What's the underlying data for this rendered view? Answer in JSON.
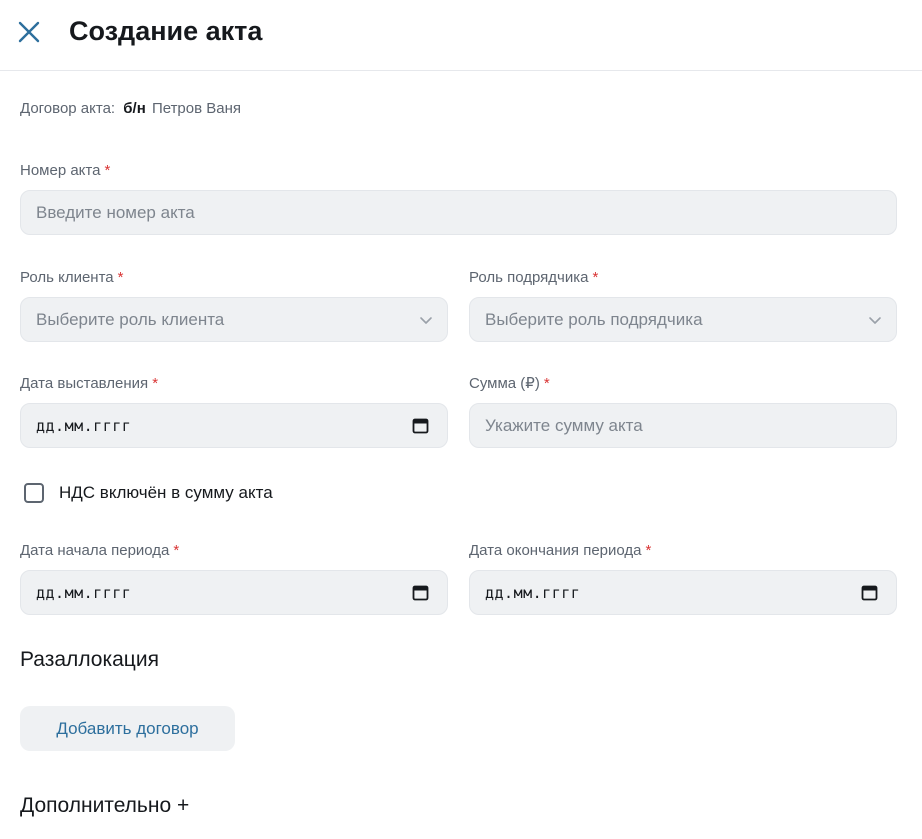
{
  "header": {
    "title": "Создание акта"
  },
  "contract": {
    "label": "Договор акта:",
    "number": "б/н",
    "name": "Петров Ваня"
  },
  "form": {
    "required_mark": "*",
    "act_number": {
      "label": "Номер акта",
      "placeholder": "Введите номер акта"
    },
    "client_role": {
      "label": "Роль клиента",
      "placeholder": "Выберите роль клиента"
    },
    "contractor_role": {
      "label": "Роль подрядчика",
      "placeholder": "Выберите роль подрядчика"
    },
    "issue_date": {
      "label": "Дата выставления",
      "value": "дд.мм.гггг"
    },
    "amount": {
      "label": "Сумма (₽)",
      "placeholder": "Укажите сумму акта"
    },
    "vat": {
      "label": "НДС включён в сумму акта",
      "checked": false
    },
    "period_start": {
      "label": "Дата начала периода",
      "value": "дд.мм.гггг"
    },
    "period_end": {
      "label": "Дата окончания периода",
      "value": "дд.мм.гггг"
    }
  },
  "reallocation": {
    "title": "Разаллокация",
    "add_button": "Добавить договор"
  },
  "additional": {
    "title": "Дополнительно +"
  },
  "colors": {
    "required": "#d93434",
    "link_button": "#2d6f9d",
    "field_bg": "#eff1f3"
  },
  "icons": {
    "close": "close-icon",
    "select": "chevron-down-icon",
    "date": "calendar-icon"
  }
}
